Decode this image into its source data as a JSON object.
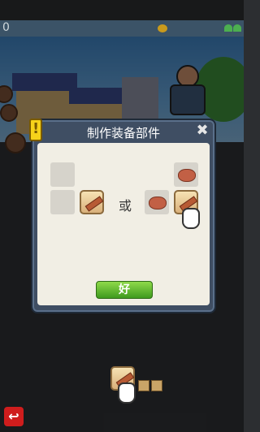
{
  "hud": {
    "score": "0",
    "hearts": 2
  },
  "dialog": {
    "title": "制作装备部件",
    "or_label": "或",
    "ok_label": "好",
    "close_glyph": "✖",
    "alert_glyph": "!"
  },
  "nav": {
    "back_glyph": "↩"
  },
  "icons": {
    "plank": "plank-icon",
    "stone": "stone-icon",
    "hand": "pointer-hand-icon"
  },
  "colors": {
    "ok_button": "#5cb52a",
    "panel": "#3f4e63",
    "back_button": "#cf1d1d"
  }
}
